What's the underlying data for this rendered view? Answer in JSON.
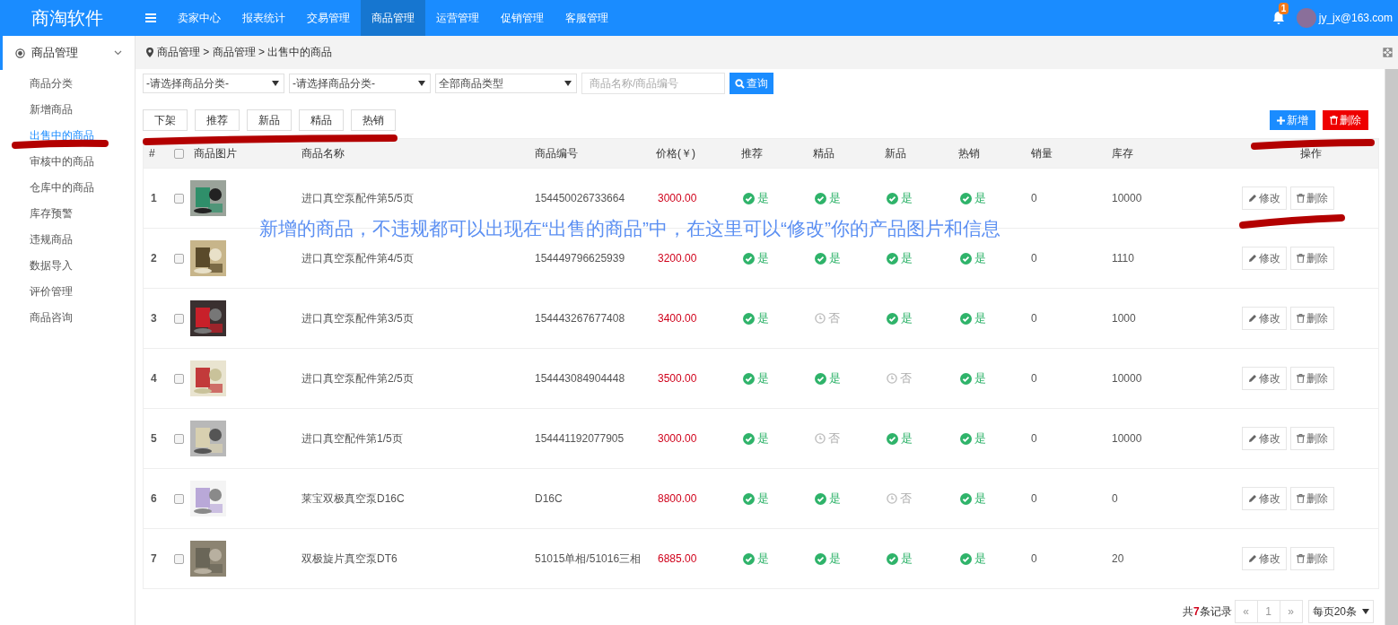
{
  "app": {
    "logo": "商淘软件"
  },
  "top_menu": [
    {
      "label": "卖家中心",
      "selected": false
    },
    {
      "label": "报表统计",
      "selected": false
    },
    {
      "label": "交易管理",
      "selected": false
    },
    {
      "label": "商品管理",
      "selected": true
    },
    {
      "label": "运营管理",
      "selected": false
    },
    {
      "label": "促销管理",
      "selected": false
    },
    {
      "label": "客服管理",
      "selected": false
    }
  ],
  "notifications": {
    "badge": "1"
  },
  "user": {
    "email": "jy_jx@163.com"
  },
  "sidebar": {
    "title": "商品管理",
    "expanded": true,
    "items": [
      {
        "label": "商品分类",
        "selected": false
      },
      {
        "label": "新增商品",
        "selected": false
      },
      {
        "label": "出售中的商品",
        "selected": true
      },
      {
        "label": "审核中的商品",
        "selected": false
      },
      {
        "label": "仓库中的商品",
        "selected": false
      },
      {
        "label": "库存预警",
        "selected": false
      },
      {
        "label": "违规商品",
        "selected": false
      },
      {
        "label": "数据导入",
        "selected": false
      },
      {
        "label": "评价管理",
        "selected": false
      },
      {
        "label": "商品咨询",
        "selected": false
      }
    ]
  },
  "breadcrumb": "商品管理 > 商品管理 > 出售中的商品",
  "filters": {
    "selects": [
      "-请选择商品分类-",
      "-请选择商品分类-",
      "全部商品类型"
    ],
    "search_placeholder": "商品名称/商品编号",
    "query_button": "查询"
  },
  "batch_buttons": [
    "下架",
    "推荐",
    "新品",
    "精品",
    "热销"
  ],
  "add_button": "新增",
  "delete_button": "删除",
  "table": {
    "select_all_checked": false,
    "columns": [
      "#",
      "商品图片",
      "商品名称",
      "商品编号",
      "价格(￥)",
      "推荐",
      "精品",
      "新品",
      "热销",
      "销量",
      "库存",
      "操作"
    ],
    "rows": [
      {
        "index": "1",
        "checked": false,
        "name": "进口真空泵配件第5/5页",
        "code": "154450026733664",
        "price": "3000.00",
        "flags": [
          {
            "text": "是",
            "on": true
          },
          {
            "text": "是",
            "on": true
          },
          {
            "text": "是",
            "on": true
          },
          {
            "text": "是",
            "on": true
          }
        ],
        "sales": "0",
        "stock": "10000",
        "actions": [
          "修改",
          "删除"
        ]
      },
      {
        "index": "2",
        "checked": false,
        "name": "进口真空泵配件第4/5页",
        "code": "154449796625939",
        "price": "3200.00",
        "flags": [
          {
            "text": "是",
            "on": true
          },
          {
            "text": "是",
            "on": true
          },
          {
            "text": "是",
            "on": true
          },
          {
            "text": "是",
            "on": true
          }
        ],
        "sales": "0",
        "stock": "1110",
        "actions": [
          "修改",
          "删除"
        ]
      },
      {
        "index": "3",
        "checked": false,
        "name": "进口真空泵配件第3/5页",
        "code": "154443267677408",
        "price": "3400.00",
        "flags": [
          {
            "text": "是",
            "on": true
          },
          {
            "text": "否",
            "on": false
          },
          {
            "text": "是",
            "on": true
          },
          {
            "text": "是",
            "on": true
          }
        ],
        "sales": "0",
        "stock": "1000",
        "actions": [
          "修改",
          "删除"
        ]
      },
      {
        "index": "4",
        "checked": false,
        "name": "进口真空泵配件第2/5页",
        "code": "154443084904448",
        "price": "3500.00",
        "flags": [
          {
            "text": "是",
            "on": true
          },
          {
            "text": "是",
            "on": true
          },
          {
            "text": "否",
            "on": false
          },
          {
            "text": "是",
            "on": true
          }
        ],
        "sales": "0",
        "stock": "10000",
        "actions": [
          "修改",
          "删除"
        ]
      },
      {
        "index": "5",
        "checked": false,
        "name": "进口真空配件第1/5页",
        "code": "154441192077905",
        "price": "3000.00",
        "flags": [
          {
            "text": "是",
            "on": true
          },
          {
            "text": "否",
            "on": false
          },
          {
            "text": "是",
            "on": true
          },
          {
            "text": "是",
            "on": true
          }
        ],
        "sales": "0",
        "stock": "10000",
        "actions": [
          "修改",
          "删除"
        ]
      },
      {
        "index": "6",
        "checked": false,
        "name": "莱宝双极真空泵D16C",
        "code": "D16C",
        "price": "8800.00",
        "flags": [
          {
            "text": "是",
            "on": true
          },
          {
            "text": "是",
            "on": true
          },
          {
            "text": "否",
            "on": false
          },
          {
            "text": "是",
            "on": true
          }
        ],
        "sales": "0",
        "stock": "0",
        "actions": [
          "修改",
          "删除"
        ]
      },
      {
        "index": "7",
        "checked": false,
        "name": "双极旋片真空泵DT6",
        "code": "51015单相/51016三相",
        "price": "6885.00",
        "flags": [
          {
            "text": "是",
            "on": true
          },
          {
            "text": "是",
            "on": true
          },
          {
            "text": "是",
            "on": true
          },
          {
            "text": "是",
            "on": true
          }
        ],
        "sales": "0",
        "stock": "20",
        "actions": [
          "修改",
          "删除"
        ]
      }
    ]
  },
  "annotation": "新增的商品，不违规都可以出现在“出售的商品”中，在这里可以“修改”你的产品图片和信息",
  "pagination": {
    "summary": "共**7**条记录",
    "prev": "«",
    "pages": [
      {
        "label": "1",
        "selected": false
      }
    ],
    "next": "»",
    "page_size": "每页20条"
  }
}
